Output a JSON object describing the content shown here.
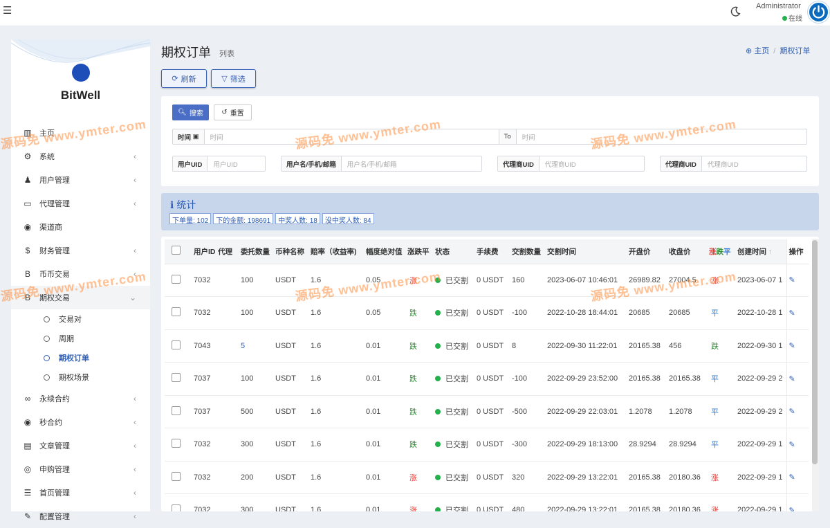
{
  "topbar": {
    "admin_name": "Administrator",
    "admin_status": "在线"
  },
  "brand": {
    "name": "BitWell"
  },
  "sidebar": {
    "items": [
      {
        "label": "主页",
        "icon": "bar-chart-icon",
        "glyph": "▥",
        "arrow": false
      },
      {
        "label": "系统",
        "icon": "gear-icon",
        "glyph": "⚙",
        "arrow": true
      },
      {
        "label": "用户管理",
        "icon": "users-icon",
        "glyph": "♟",
        "arrow": true
      },
      {
        "label": "代理管理",
        "icon": "id-card-icon",
        "glyph": "▭",
        "arrow": true
      },
      {
        "label": "渠道商",
        "icon": "user-circle-icon",
        "glyph": "◉",
        "arrow": false
      },
      {
        "label": "财务管理",
        "icon": "dollar-icon",
        "glyph": "$",
        "arrow": true
      },
      {
        "label": "币币交易",
        "icon": "bitcoin-icon",
        "glyph": "B",
        "arrow": true
      },
      {
        "label": "期权交易",
        "icon": "bitcoin-icon",
        "glyph": "B",
        "arrow": true,
        "open": true
      }
    ],
    "subitems": [
      {
        "label": "交易对",
        "active": false
      },
      {
        "label": "周期",
        "active": false
      },
      {
        "label": "期权订单",
        "active": true
      },
      {
        "label": "期权场景",
        "active": false
      }
    ],
    "items_after": [
      {
        "label": "永续合约",
        "icon": "link-icon",
        "glyph": "∞",
        "arrow": true
      },
      {
        "label": "秒合约",
        "icon": "dot-circle-icon",
        "glyph": "◉",
        "arrow": true
      },
      {
        "label": "文章管理",
        "icon": "newspaper-icon",
        "glyph": "▤",
        "arrow": true
      },
      {
        "label": "申购管理",
        "icon": "life-ring-icon",
        "glyph": "◎",
        "arrow": true
      },
      {
        "label": "首页管理",
        "icon": "list-icon",
        "glyph": "☰",
        "arrow": true
      },
      {
        "label": "配置管理",
        "icon": "wrench-icon",
        "glyph": "✎",
        "arrow": true
      }
    ]
  },
  "page": {
    "title": "期权订单",
    "subtitle": "列表"
  },
  "breadcrumb": {
    "home": "主页",
    "current": "期权订单"
  },
  "toolbar": {
    "refresh": "刷新",
    "filter": "筛选"
  },
  "filter": {
    "search": "搜索",
    "reset": "重置",
    "time_label": "时间",
    "time_placeholder": "时间",
    "to_label": "To",
    "time_to_placeholder": "时间",
    "uid_label": "用户UID",
    "uid_placeholder": "用户UID",
    "name_label": "用户名/手机/邮箱",
    "name_placeholder": "用户名/手机/邮箱",
    "agent_label": "代理商UID",
    "agent_placeholder": "代理商UID",
    "agent2_label": "代理商UID",
    "agent2_placeholder": "代理商UID"
  },
  "stats": {
    "title": "统计",
    "badges": [
      "下单量: 102",
      "下的金额: 198691",
      "中奖人数: 18",
      "没中奖人数: 84"
    ]
  },
  "table": {
    "headers": [
      "用户ID",
      "代理",
      "委托数量",
      "币种名称",
      "赔率（收益率)",
      "幅度绝对值",
      "涨跌平",
      "状态",
      "手续费",
      "交割数量",
      "交割时间",
      "开盘价",
      "收盘价",
      "",
      "创建时间",
      "操作"
    ],
    "result_header": {
      "up": "涨",
      "down": "跌",
      "flat": "平"
    },
    "rows": [
      {
        "uid": "7032",
        "agent": "",
        "qty": "100",
        "coin": "USDT",
        "odds": "1.6",
        "range": "0.05",
        "dir": "涨",
        "dir_cls": "up",
        "status": "已交割",
        "fee": "0 USDT",
        "settle": "160",
        "settle_time": "2023-06-07 10:46:01",
        "open": "26989.82",
        "close": "27004.5",
        "res": "涨",
        "res_cls": "up",
        "created": "2023-06-07 1"
      },
      {
        "uid": "7032",
        "agent": "",
        "qty": "100",
        "coin": "USDT",
        "odds": "1.6",
        "range": "0.05",
        "dir": "跌",
        "dir_cls": "down",
        "status": "已交割",
        "fee": "0 USDT",
        "settle": "-100",
        "settle_time": "2022-10-28 18:44:01",
        "open": "20685",
        "close": "20685",
        "res": "平",
        "res_cls": "flat",
        "created": "2022-10-28 1"
      },
      {
        "uid": "7043",
        "agent": "",
        "qty": "5",
        "coin": "USDT",
        "odds": "1.6",
        "range": "0.01",
        "dir": "跌",
        "dir_cls": "down",
        "status": "已交割",
        "fee": "0 USDT",
        "settle": "8",
        "settle_time": "2022-09-30 11:22:01",
        "open": "20165.38",
        "close": "456",
        "res": "跌",
        "res_cls": "down",
        "created": "2022-09-30 1"
      },
      {
        "uid": "7037",
        "agent": "",
        "qty": "100",
        "coin": "USDT",
        "odds": "1.6",
        "range": "0.01",
        "dir": "跌",
        "dir_cls": "down",
        "status": "已交割",
        "fee": "0 USDT",
        "settle": "-100",
        "settle_time": "2022-09-29 23:52:00",
        "open": "20165.38",
        "close": "20165.38",
        "res": "平",
        "res_cls": "flat",
        "created": "2022-09-29 2"
      },
      {
        "uid": "7037",
        "agent": "",
        "qty": "500",
        "coin": "USDT",
        "odds": "1.6",
        "range": "0.01",
        "dir": "跌",
        "dir_cls": "down",
        "status": "已交割",
        "fee": "0 USDT",
        "settle": "-500",
        "settle_time": "2022-09-29 22:03:01",
        "open": "1.2078",
        "close": "1.2078",
        "res": "平",
        "res_cls": "flat",
        "created": "2022-09-29 2"
      },
      {
        "uid": "7032",
        "agent": "",
        "qty": "300",
        "coin": "USDT",
        "odds": "1.6",
        "range": "0.01",
        "dir": "跌",
        "dir_cls": "down",
        "status": "已交割",
        "fee": "0 USDT",
        "settle": "-300",
        "settle_time": "2022-09-29 18:13:00",
        "open": "28.9294",
        "close": "28.9294",
        "res": "平",
        "res_cls": "flat",
        "created": "2022-09-29 1"
      },
      {
        "uid": "7032",
        "agent": "",
        "qty": "200",
        "coin": "USDT",
        "odds": "1.6",
        "range": "0.01",
        "dir": "涨",
        "dir_cls": "up",
        "status": "已交割",
        "fee": "0 USDT",
        "settle": "320",
        "settle_time": "2022-09-29 13:22:01",
        "open": "20165.38",
        "close": "20180.36",
        "res": "涨",
        "res_cls": "up",
        "created": "2022-09-29 1"
      },
      {
        "uid": "7032",
        "agent": "",
        "qty": "300",
        "coin": "USDT",
        "odds": "1.6",
        "range": "0.01",
        "dir": "涨",
        "dir_cls": "up",
        "status": "已交割",
        "fee": "0 USDT",
        "settle": "480",
        "settle_time": "2022-09-29 13:22:01",
        "open": "20165.38",
        "close": "20180.36",
        "res": "涨",
        "res_cls": "up",
        "created": "2022-09-29 1"
      }
    ]
  },
  "watermark": {
    "text": "源码免  www.ymter.com",
    "color": "#ff8c3c"
  }
}
